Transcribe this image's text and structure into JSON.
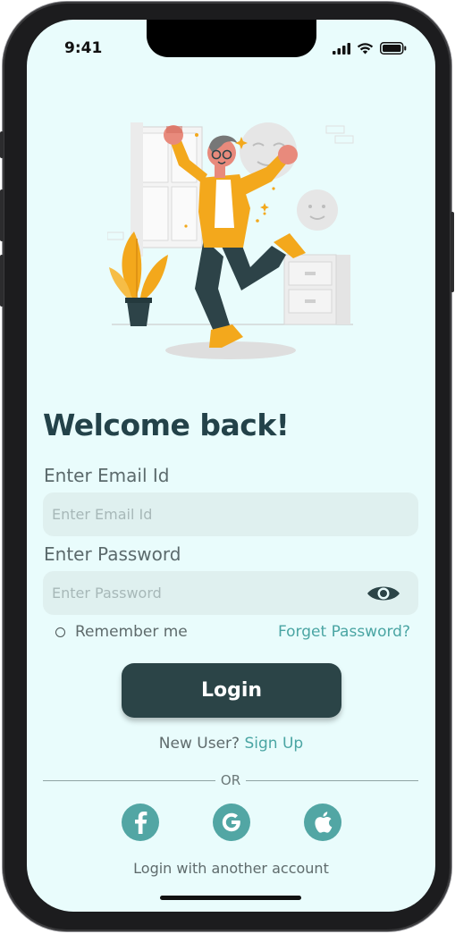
{
  "status_bar": {
    "time": "9:41"
  },
  "login": {
    "title": "Welcome back!",
    "email_label": "Enter Email Id",
    "email_placeholder": "Enter Email Id",
    "email_value": "",
    "password_label": "Enter Password",
    "password_placeholder": "Enter Password",
    "password_value": "",
    "remember_label": "Remember me",
    "remember_checked": false,
    "forgot_label": "Forget Password?",
    "login_button": "Login",
    "new_user_text": "New User?",
    "signup_link": "Sign Up",
    "divider_text": "OR",
    "social_caption": "Login with another account",
    "social_icons": [
      "facebook-icon",
      "google-icon",
      "apple-icon"
    ]
  },
  "colors": {
    "background": "#e9fcfc",
    "primary": "#2b4447",
    "accent": "#52a6a4",
    "field_bg": "#dff0ef"
  }
}
